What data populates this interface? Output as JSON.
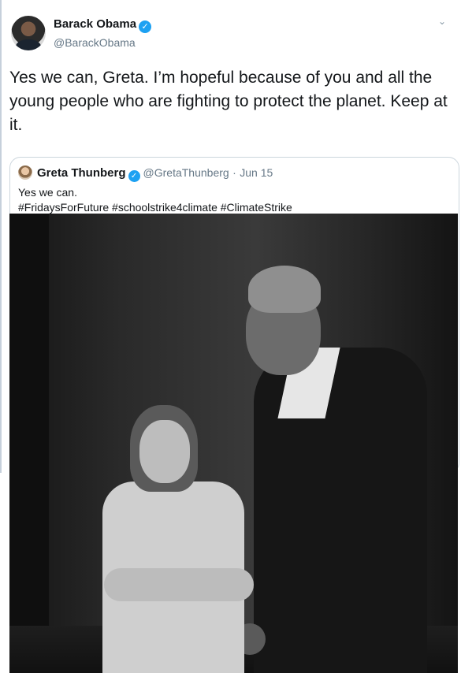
{
  "tweet": {
    "author": {
      "name": "Barack Obama",
      "handle": "@BarackObama",
      "verified_icon": "verified-badge-icon"
    },
    "menu_icon": "chevron-down-icon",
    "text": "Yes we can, Greta. I’m hopeful because of you and all the young people who are fighting to protect the planet. Keep at it."
  },
  "quote": {
    "author": {
      "name": "Greta Thunberg",
      "handle": "@GretaThunberg",
      "verified_icon": "verified-badge-icon"
    },
    "separator": "·",
    "date": "Jun 15",
    "text_line1": "Yes we can.",
    "text_line2": "#FridaysForFuture #schoolstrike4climate #ClimateStrike"
  },
  "colors": {
    "verified": "#1da1f2",
    "secondary_text": "#657786",
    "border": "#ccd6dd"
  }
}
